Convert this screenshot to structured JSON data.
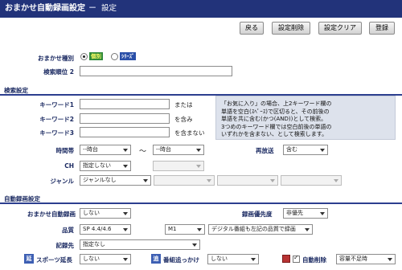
{
  "header": {
    "title": "おまかせ自動録画設定",
    "separator": "－",
    "subtitle": "設定"
  },
  "toolbar": {
    "back": "戻る",
    "delete": "設定削除",
    "clear": "設定クリア",
    "register": "登録"
  },
  "type": {
    "label": "おまかせ種別",
    "opt1": "個別",
    "opt2": "ｼﾘｰｽﾞ",
    "selected": "個別"
  },
  "priority": {
    "label": "検索順位",
    "number": "2",
    "value": ""
  },
  "search": {
    "section": "検索設定",
    "kw1_label": "キーワード1",
    "kw1_suffix": "または",
    "kw2_label": "キーワード2",
    "kw2_suffix": "を含み",
    "kw3_label": "キーワード3",
    "kw3_suffix": "を含まない",
    "info": [
      "「お気に入り」の場合、上2キーワード欄の",
      "単語を空白(ｽﾍﾟｰｽ)で区切ると、その前後の",
      "単語を共に含む(かつ(AND))として検索。",
      "3つめのキーワード欄では空白前後の単語の",
      "いずれかを含まない、として検索します。"
    ],
    "time_label": "時間帯",
    "time_from": "--時台",
    "time_tilde": "～",
    "time_to": "--時台",
    "rerun_label": "再放送",
    "rerun_value": "含む",
    "ch_label": "CH",
    "ch_value": "指定しない",
    "genre_label": "ジャンル",
    "genre_value": "ジャンルなし"
  },
  "auto": {
    "section": "自動録画設定",
    "auto_label": "おまかせ自動録画",
    "auto_value": "しない",
    "prio_label": "録画優先度",
    "prio_value": "非優先",
    "quality_label": "品質",
    "quality_value": "SP 4.4/4.6",
    "mode_value": "M1",
    "digital_value": "デジタル番組も左記の品質で録画",
    "dest_label": "記録先",
    "dest_value": "指定なし",
    "sports_icon": "延",
    "sports_label": "スポーツ延長",
    "sports_value": "しない",
    "follow_icon": "追",
    "follow_label": "番組追っかけ",
    "follow_value": "しない",
    "autodel_label": "自動削除",
    "autodel_value": "容量不足時"
  },
  "colors": {
    "header_bg": "#22337a",
    "label": "#1b2a62",
    "badge_green": "#2f8a3a",
    "badge_blue": "#2a4fa8"
  }
}
